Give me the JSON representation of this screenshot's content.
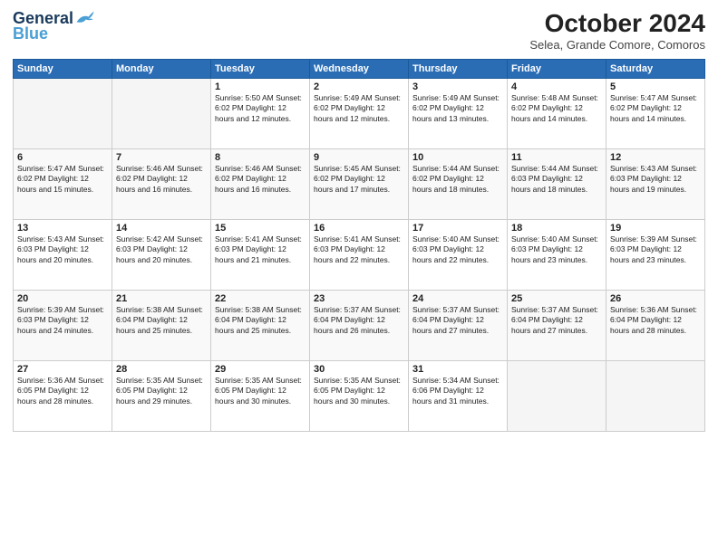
{
  "header": {
    "logo_line1": "General",
    "logo_line2": "Blue",
    "month": "October 2024",
    "location": "Selea, Grande Comore, Comoros"
  },
  "weekdays": [
    "Sunday",
    "Monday",
    "Tuesday",
    "Wednesday",
    "Thursday",
    "Friday",
    "Saturday"
  ],
  "weeks": [
    [
      {
        "day": "",
        "info": ""
      },
      {
        "day": "",
        "info": ""
      },
      {
        "day": "1",
        "info": "Sunrise: 5:50 AM\nSunset: 6:02 PM\nDaylight: 12 hours\nand 12 minutes."
      },
      {
        "day": "2",
        "info": "Sunrise: 5:49 AM\nSunset: 6:02 PM\nDaylight: 12 hours\nand 12 minutes."
      },
      {
        "day": "3",
        "info": "Sunrise: 5:49 AM\nSunset: 6:02 PM\nDaylight: 12 hours\nand 13 minutes."
      },
      {
        "day": "4",
        "info": "Sunrise: 5:48 AM\nSunset: 6:02 PM\nDaylight: 12 hours\nand 14 minutes."
      },
      {
        "day": "5",
        "info": "Sunrise: 5:47 AM\nSunset: 6:02 PM\nDaylight: 12 hours\nand 14 minutes."
      }
    ],
    [
      {
        "day": "6",
        "info": "Sunrise: 5:47 AM\nSunset: 6:02 PM\nDaylight: 12 hours\nand 15 minutes."
      },
      {
        "day": "7",
        "info": "Sunrise: 5:46 AM\nSunset: 6:02 PM\nDaylight: 12 hours\nand 16 minutes."
      },
      {
        "day": "8",
        "info": "Sunrise: 5:46 AM\nSunset: 6:02 PM\nDaylight: 12 hours\nand 16 minutes."
      },
      {
        "day": "9",
        "info": "Sunrise: 5:45 AM\nSunset: 6:02 PM\nDaylight: 12 hours\nand 17 minutes."
      },
      {
        "day": "10",
        "info": "Sunrise: 5:44 AM\nSunset: 6:02 PM\nDaylight: 12 hours\nand 18 minutes."
      },
      {
        "day": "11",
        "info": "Sunrise: 5:44 AM\nSunset: 6:03 PM\nDaylight: 12 hours\nand 18 minutes."
      },
      {
        "day": "12",
        "info": "Sunrise: 5:43 AM\nSunset: 6:03 PM\nDaylight: 12 hours\nand 19 minutes."
      }
    ],
    [
      {
        "day": "13",
        "info": "Sunrise: 5:43 AM\nSunset: 6:03 PM\nDaylight: 12 hours\nand 20 minutes."
      },
      {
        "day": "14",
        "info": "Sunrise: 5:42 AM\nSunset: 6:03 PM\nDaylight: 12 hours\nand 20 minutes."
      },
      {
        "day": "15",
        "info": "Sunrise: 5:41 AM\nSunset: 6:03 PM\nDaylight: 12 hours\nand 21 minutes."
      },
      {
        "day": "16",
        "info": "Sunrise: 5:41 AM\nSunset: 6:03 PM\nDaylight: 12 hours\nand 22 minutes."
      },
      {
        "day": "17",
        "info": "Sunrise: 5:40 AM\nSunset: 6:03 PM\nDaylight: 12 hours\nand 22 minutes."
      },
      {
        "day": "18",
        "info": "Sunrise: 5:40 AM\nSunset: 6:03 PM\nDaylight: 12 hours\nand 23 minutes."
      },
      {
        "day": "19",
        "info": "Sunrise: 5:39 AM\nSunset: 6:03 PM\nDaylight: 12 hours\nand 23 minutes."
      }
    ],
    [
      {
        "day": "20",
        "info": "Sunrise: 5:39 AM\nSunset: 6:03 PM\nDaylight: 12 hours\nand 24 minutes."
      },
      {
        "day": "21",
        "info": "Sunrise: 5:38 AM\nSunset: 6:04 PM\nDaylight: 12 hours\nand 25 minutes."
      },
      {
        "day": "22",
        "info": "Sunrise: 5:38 AM\nSunset: 6:04 PM\nDaylight: 12 hours\nand 25 minutes."
      },
      {
        "day": "23",
        "info": "Sunrise: 5:37 AM\nSunset: 6:04 PM\nDaylight: 12 hours\nand 26 minutes."
      },
      {
        "day": "24",
        "info": "Sunrise: 5:37 AM\nSunset: 6:04 PM\nDaylight: 12 hours\nand 27 minutes."
      },
      {
        "day": "25",
        "info": "Sunrise: 5:37 AM\nSunset: 6:04 PM\nDaylight: 12 hours\nand 27 minutes."
      },
      {
        "day": "26",
        "info": "Sunrise: 5:36 AM\nSunset: 6:04 PM\nDaylight: 12 hours\nand 28 minutes."
      }
    ],
    [
      {
        "day": "27",
        "info": "Sunrise: 5:36 AM\nSunset: 6:05 PM\nDaylight: 12 hours\nand 28 minutes."
      },
      {
        "day": "28",
        "info": "Sunrise: 5:35 AM\nSunset: 6:05 PM\nDaylight: 12 hours\nand 29 minutes."
      },
      {
        "day": "29",
        "info": "Sunrise: 5:35 AM\nSunset: 6:05 PM\nDaylight: 12 hours\nand 30 minutes."
      },
      {
        "day": "30",
        "info": "Sunrise: 5:35 AM\nSunset: 6:05 PM\nDaylight: 12 hours\nand 30 minutes."
      },
      {
        "day": "31",
        "info": "Sunrise: 5:34 AM\nSunset: 6:06 PM\nDaylight: 12 hours\nand 31 minutes."
      },
      {
        "day": "",
        "info": ""
      },
      {
        "day": "",
        "info": ""
      }
    ]
  ]
}
